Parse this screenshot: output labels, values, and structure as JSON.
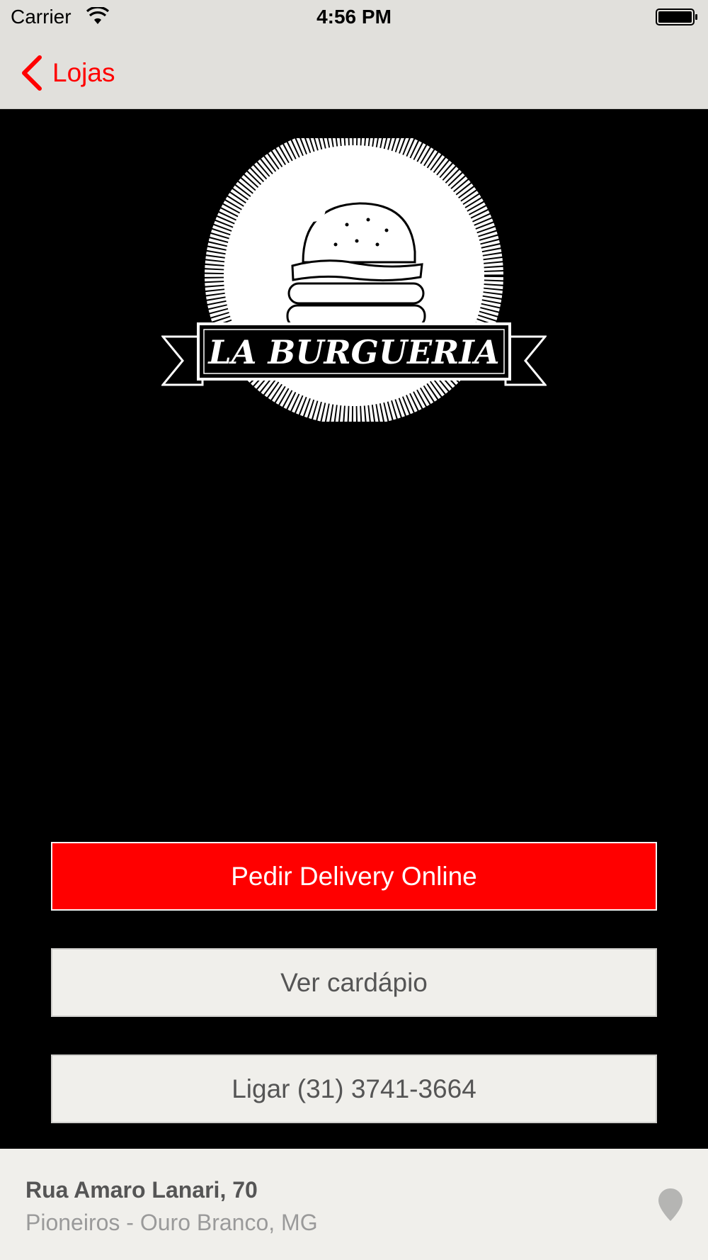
{
  "status_bar": {
    "carrier": "Carrier",
    "time": "4:56 PM"
  },
  "nav": {
    "back_label": "Lojas"
  },
  "logo": {
    "text": "LA BURGUERIA"
  },
  "buttons": {
    "delivery": "Pedir Delivery Online",
    "menu": "Ver cardápio",
    "call": "Ligar (31) 3741-3664"
  },
  "address": {
    "street": "Rua Amaro Lanari, 70",
    "city": "Pioneiros - Ouro Branco, MG"
  },
  "colors": {
    "accent": "#ff0000",
    "bar_background": "#e1e0dc",
    "button_light": "#f0efeb"
  },
  "icons": {
    "back": "chevron-left-icon",
    "wifi": "wifi-icon",
    "battery": "battery-icon",
    "location": "map-pin-icon"
  }
}
